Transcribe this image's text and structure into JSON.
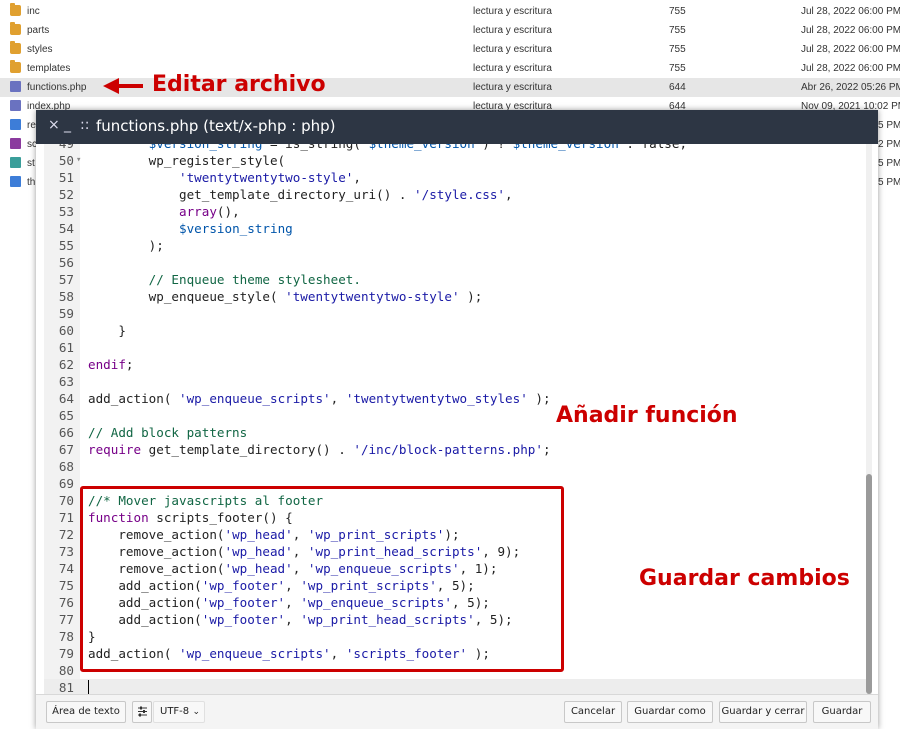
{
  "file_manager": {
    "rows": [
      {
        "name": "inc",
        "perm": "lectura y escritura",
        "num": "755",
        "date": "Jul 28, 2022 06:00 PM",
        "icon": "folder-icon"
      },
      {
        "name": "parts",
        "perm": "lectura y escritura",
        "num": "755",
        "date": "Jul 28, 2022 06:00 PM",
        "icon": "folder-icon"
      },
      {
        "name": "styles",
        "perm": "lectura y escritura",
        "num": "755",
        "date": "Jul 28, 2022 06:00 PM",
        "icon": "folder-icon"
      },
      {
        "name": "templates",
        "perm": "lectura y escritura",
        "num": "755",
        "date": "Jul 28, 2022 06:00 PM",
        "icon": "folder-icon"
      },
      {
        "name": "functions.php",
        "perm": "lectura y escritura",
        "num": "644",
        "date": "Abr 26, 2022 05:26 PM",
        "icon": "php-file-icon"
      },
      {
        "name": "index.php",
        "perm": "lectura y escritura",
        "num": "644",
        "date": "Nov 09, 2021 10:02 PM",
        "icon": "php-file-icon"
      }
    ],
    "partial_rows": [
      {
        "name": "re",
        "date": "5 PM",
        "icon": "file-icon"
      },
      {
        "name": "sc",
        "date": "2 PM",
        "icon": "image-file-icon"
      },
      {
        "name": "st",
        "date": "5 PM",
        "icon": "css-file-icon"
      },
      {
        "name": "th",
        "date": "5 PM",
        "icon": "file-icon"
      }
    ]
  },
  "annotations": {
    "edit_file": "Editar archivo",
    "add_function": "Añadir función",
    "save_changes": "Guardar cambios",
    "color": "#cc0000"
  },
  "editor": {
    "close": "×",
    "minimize": "_",
    "drag": "::",
    "title": "functions.php (text/x-php : php)",
    "lines": [
      {
        "n": "49",
        "text": "        $version_string = is_string( $theme_version ) ? $theme_version : false;"
      },
      {
        "n": "50",
        "text": "        wp_register_style(",
        "fold": "▾"
      },
      {
        "n": "51",
        "text": "            'twentytwentytwo-style',"
      },
      {
        "n": "52",
        "text": "            get_template_directory_uri() . '/style.css',"
      },
      {
        "n": "53",
        "text": "            array(),"
      },
      {
        "n": "54",
        "text": "            $version_string"
      },
      {
        "n": "55",
        "text": "        );"
      },
      {
        "n": "56",
        "text": ""
      },
      {
        "n": "57",
        "text": "        // Enqueue theme stylesheet."
      },
      {
        "n": "58",
        "text": "        wp_enqueue_style( 'twentytwentytwo-style' );"
      },
      {
        "n": "59",
        "text": ""
      },
      {
        "n": "60",
        "text": "    }"
      },
      {
        "n": "61",
        "text": ""
      },
      {
        "n": "62",
        "text": "endif;"
      },
      {
        "n": "63",
        "text": ""
      },
      {
        "n": "64",
        "text": "add_action( 'wp_enqueue_scripts', 'twentytwentytwo_styles' );"
      },
      {
        "n": "65",
        "text": ""
      },
      {
        "n": "66",
        "text": "// Add block patterns"
      },
      {
        "n": "67",
        "text": "require get_template_directory() . '/inc/block-patterns.php';"
      },
      {
        "n": "68",
        "text": ""
      },
      {
        "n": "69",
        "text": ""
      },
      {
        "n": "70",
        "text": "//* Mover javascripts al footer"
      },
      {
        "n": "71",
        "text": "function scripts_footer() {"
      },
      {
        "n": "72",
        "text": "    remove_action('wp_head', 'wp_print_scripts');"
      },
      {
        "n": "73",
        "text": "    remove_action('wp_head', 'wp_print_head_scripts', 9);"
      },
      {
        "n": "74",
        "text": "    remove_action('wp_head', 'wp_enqueue_scripts', 1);"
      },
      {
        "n": "75",
        "text": "    add_action('wp_footer', 'wp_print_scripts', 5);"
      },
      {
        "n": "76",
        "text": "    add_action('wp_footer', 'wp_enqueue_scripts', 5);"
      },
      {
        "n": "77",
        "text": "    add_action('wp_footer', 'wp_print_head_scripts', 5);"
      },
      {
        "n": "78",
        "text": "}"
      },
      {
        "n": "79",
        "text": "add_action( 'wp_enqueue_scripts', 'scripts_footer' );"
      },
      {
        "n": "80",
        "text": ""
      },
      {
        "n": "81",
        "text": "",
        "active": true
      }
    ]
  },
  "toolbar": {
    "text_area_label": "Área de texto",
    "encoding": "UTF-8",
    "cancel": "Cancelar",
    "save_as": "Guardar como",
    "save_close": "Guardar y cerrar",
    "save": "Guardar"
  }
}
